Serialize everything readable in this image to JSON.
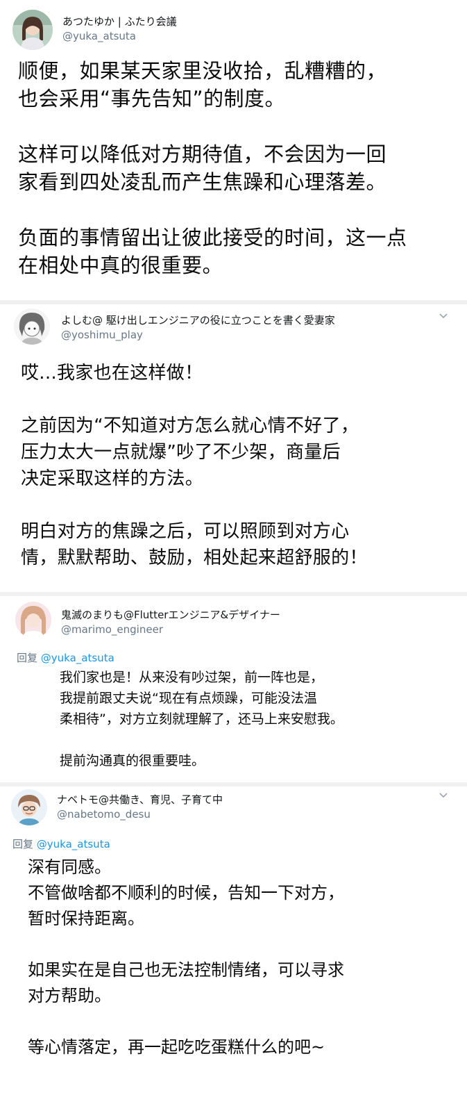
{
  "tweets": [
    {
      "display_name": "あつたゆか | ふたり会議",
      "handle": "@yuka_atsuta",
      "text": "顺便，如果某天家里没收拾，乱糟糟的，\n也会采用“事先告知”的制度。\n\n这样可以降低对方期待值，不会因为一回\n家看到四处凌乱而产生焦躁和心理落差。\n\n负面的事情留出让彼此接受的时间，这一点\n在相处中真的很重要。"
    },
    {
      "display_name": "よしむ@ 駆け出しエンジニアの役に立つことを書く愛妻家",
      "handle": "@yoshimu_play",
      "text": "哎...我家也在这样做！\n\n之前因为“不知道对方怎么就心情不好了，\n压力太大一点就爆”吵了不少架，商量后\n决定采取这样的方法。\n\n明白对方的焦躁之后，可以照顾到对方心\n情，默默帮助、鼓励，相处起来超舒服的！"
    },
    {
      "display_name": "鬼滅のまりも@Flutterエンジニア&デザイナー",
      "handle": "@marimo_engineer",
      "reply_prefix": "回复",
      "reply_to": "@yuka_atsuta",
      "text": "我们家也是！从来没有吵过架，前一阵也是，\n我提前跟丈夫说“现在有点烦躁，可能没法温\n柔相待”，对方立刻就理解了，还马上来安慰我。\n\n提前沟通真的很重要哇。"
    },
    {
      "display_name": "ナベトモ@共働き、育児、子育て中",
      "handle": "@nabetomo_desu",
      "reply_prefix": "回复",
      "reply_to": "@yuka_atsuta",
      "text": "深有同感。\n不管做啥都不顺利的时候，告知一下对方，\n暂时保持距离。\n\n如果实在是自己也无法控制情绪，可以寻求\n对方帮助。\n\n等心情落定，再一起吃吃蛋糕什么的吧~"
    }
  ],
  "icons": {
    "more": "chevron-down-icon"
  }
}
